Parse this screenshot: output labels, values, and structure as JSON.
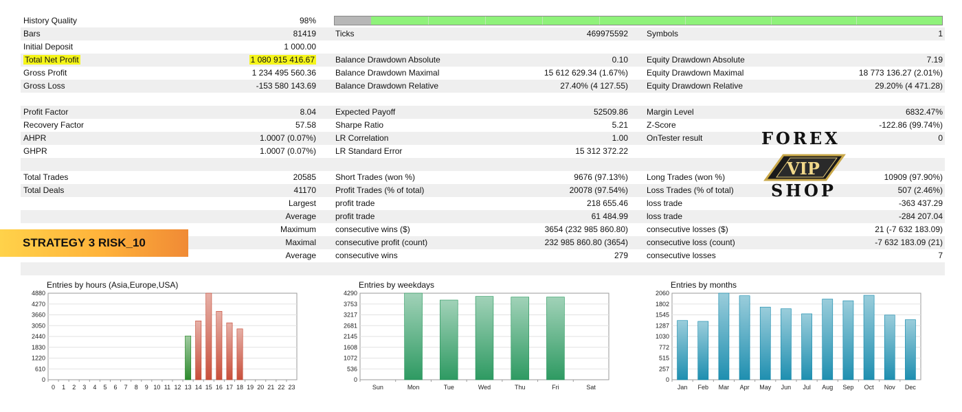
{
  "history_quality": {
    "label": "History Quality",
    "value": "98%",
    "fraction": 0.94
  },
  "rows": [
    {
      "c1l": "Bars",
      "c1v": "81419",
      "c2l": "Ticks",
      "c2v": "469975592",
      "c3l": "Symbols",
      "c3v": "1"
    },
    {
      "c1l": "Initial Deposit",
      "c1v": "1 000.00",
      "c2l": "",
      "c2v": "",
      "c3l": "",
      "c3v": ""
    },
    {
      "c1l": "Total Net Profit",
      "c1v": "1 080 915 416.67",
      "c2l": "Balance Drawdown Absolute",
      "c2v": "0.10",
      "c3l": "Equity Drawdown Absolute",
      "c3v": "7.19"
    },
    {
      "c1l": "Gross Profit",
      "c1v": "1 234 495 560.36",
      "c2l": "Balance Drawdown Maximal",
      "c2v": "15 612 629.34 (1.67%)",
      "c3l": "Equity Drawdown Maximal",
      "c3v": "18 773 136.27 (2.01%)"
    },
    {
      "c1l": "Gross Loss",
      "c1v": "-153 580 143.69",
      "c2l": "Balance Drawdown Relative",
      "c2v": "27.40% (4 127.55)",
      "c3l": "Equity Drawdown Relative",
      "c3v": "29.20% (4 471.28)"
    },
    {
      "c1l": "",
      "c1v": "",
      "c2l": "",
      "c2v": "",
      "c3l": "",
      "c3v": ""
    },
    {
      "c1l": "Profit Factor",
      "c1v": "8.04",
      "c2l": "Expected Payoff",
      "c2v": "52509.86",
      "c3l": "Margin Level",
      "c3v": "6832.47%"
    },
    {
      "c1l": "Recovery Factor",
      "c1v": "57.58",
      "c2l": "Sharpe Ratio",
      "c2v": "5.21",
      "c3l": "Z-Score",
      "c3v": "-122.86 (99.74%)"
    },
    {
      "c1l": "AHPR",
      "c1v": "1.0007 (0.07%)",
      "c2l": "LR Correlation",
      "c2v": "1.00",
      "c3l": "OnTester result",
      "c3v": "0"
    },
    {
      "c1l": "GHPR",
      "c1v": "1.0007 (0.07%)",
      "c2l": "LR Standard Error",
      "c2v": "15 312 372.22",
      "c3l": "",
      "c3v": ""
    },
    {
      "c1l": "",
      "c1v": "",
      "c2l": "",
      "c2v": "",
      "c3l": "",
      "c3v": ""
    },
    {
      "c1l": "Total Trades",
      "c1v": "20585",
      "c2l": "Short Trades (won %)",
      "c2v": "9676 (97.13%)",
      "c3l": "Long Trades (won %)",
      "c3v": "10909 (97.90%)"
    },
    {
      "c1l": "Total Deals",
      "c1v": "41170",
      "c2l": "Profit Trades (% of total)",
      "c2v": "20078 (97.54%)",
      "c3l": "Loss Trades (% of total)",
      "c3v": "507 (2.46%)"
    },
    {
      "c1l": "",
      "c1v": "Largest",
      "c2l": "profit trade",
      "c2v": "218 655.46",
      "c3l": "loss trade",
      "c3v": "-363 437.29"
    },
    {
      "c1l": "",
      "c1v": "Average",
      "c2l": "profit trade",
      "c2v": "61 484.99",
      "c3l": "loss trade",
      "c3v": "-284 207.04"
    },
    {
      "c1l": "",
      "c1v": "Maximum",
      "c2l": "consecutive wins ($)",
      "c2v": "3654 (232 985 860.80)",
      "c3l": "consecutive losses ($)",
      "c3v": "21 (-7 632 183.09)"
    },
    {
      "c1l": "",
      "c1v": "Maximal",
      "c2l": "consecutive profit (count)",
      "c2v": "232 985 860.80 (3654)",
      "c3l": "consecutive loss (count)",
      "c3v": "-7 632 183.09 (21)"
    },
    {
      "c1l": "",
      "c1v": "Average",
      "c2l": "consecutive wins",
      "c2v": "279",
      "c3l": "consecutive losses",
      "c3v": "7"
    },
    {
      "c1l": "",
      "c1v": "",
      "c2l": "",
      "c2v": "",
      "c3l": "",
      "c3v": ""
    }
  ],
  "banner": {
    "text": "STRATEGY 3 RISK_10",
    "colors": [
      "#ffd24a",
      "#f08a35"
    ]
  },
  "logo": {
    "top": "FOREX",
    "middle": "VIP",
    "bottom": "SHOP"
  },
  "highlight_color": "#f5f51a",
  "chart_data": [
    {
      "type": "bar",
      "title": "Entries by hours (Asia,Europe,USA)",
      "categories": [
        "0",
        "1",
        "2",
        "3",
        "4",
        "5",
        "6",
        "7",
        "8",
        "9",
        "10",
        "11",
        "12",
        "13",
        "14",
        "15",
        "16",
        "17",
        "18",
        "19",
        "20",
        "21",
        "22",
        "23"
      ],
      "yticks": [
        "0",
        "610",
        "1220",
        "1830",
        "2440",
        "3050",
        "3660",
        "4270",
        "4880"
      ],
      "ylim": [
        0,
        4880
      ],
      "series": [
        {
          "values": [
            0,
            0,
            0,
            0,
            0,
            0,
            0,
            0,
            0,
            0,
            0,
            0,
            0,
            2470,
            0,
            0,
            0,
            0,
            0,
            0,
            0,
            0,
            0,
            0
          ],
          "color": "#2e8b2e"
        },
        {
          "values": [
            0,
            0,
            0,
            0,
            0,
            0,
            0,
            0,
            0,
            0,
            0,
            0,
            0,
            0,
            3320,
            4880,
            3860,
            3210,
            2870,
            0,
            0,
            0,
            0,
            0
          ],
          "color": "#c8503c"
        }
      ],
      "grid": true
    },
    {
      "type": "bar",
      "title": "Entries by weekdays",
      "categories": [
        "Sun",
        "Mon",
        "Tue",
        "Wed",
        "Thu",
        "Fri",
        "Sat"
      ],
      "yticks": [
        "0",
        "536",
        "1072",
        "1608",
        "2145",
        "2681",
        "3217",
        "3753",
        "4290"
      ],
      "ylim": [
        0,
        4290
      ],
      "values": [
        0,
        4290,
        3950,
        4130,
        4100,
        4100,
        0
      ],
      "color": "#2e9a62",
      "grid": true
    },
    {
      "type": "bar",
      "title": "Entries by months",
      "categories": [
        "Jan",
        "Feb",
        "Mar",
        "Apr",
        "May",
        "Jun",
        "Jul",
        "Aug",
        "Sep",
        "Oct",
        "Nov",
        "Dec"
      ],
      "yticks": [
        "0",
        "257",
        "515",
        "772",
        "1030",
        "1287",
        "1545",
        "1802",
        "2060"
      ],
      "ylim": [
        0,
        2060
      ],
      "values": [
        1410,
        1390,
        2060,
        2000,
        1730,
        1690,
        1570,
        1920,
        1880,
        2010,
        1540,
        1430
      ],
      "color": "#1f8fb0",
      "grid": true
    }
  ]
}
